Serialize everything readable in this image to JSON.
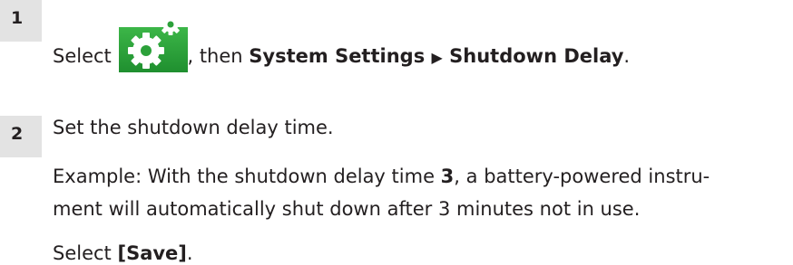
{
  "steps": [
    {
      "number": "1",
      "lead": "Select ",
      "icon": "settings-gears-icon",
      "middle": ", then ",
      "path_part1": "System Settings",
      "separator": "▶",
      "path_part2": "Shutdown Delay",
      "end": "."
    },
    {
      "number": "2",
      "instruction": "Set the shutdown delay time.",
      "example_prefix": "Example: With the shutdown delay time ",
      "example_value": "3",
      "example_suffix_line1": ", a battery-powered instru-",
      "example_line2": "ment will automatically shut down after 3 minutes not in use.",
      "save_prefix": "Select ",
      "save_label": "[Save]",
      "save_end": "."
    }
  ],
  "colors": {
    "badge_bg": "#e3e3e3",
    "icon_bg": "#2ca13a",
    "icon_fg": "#ffffff",
    "text": "#231f20"
  }
}
